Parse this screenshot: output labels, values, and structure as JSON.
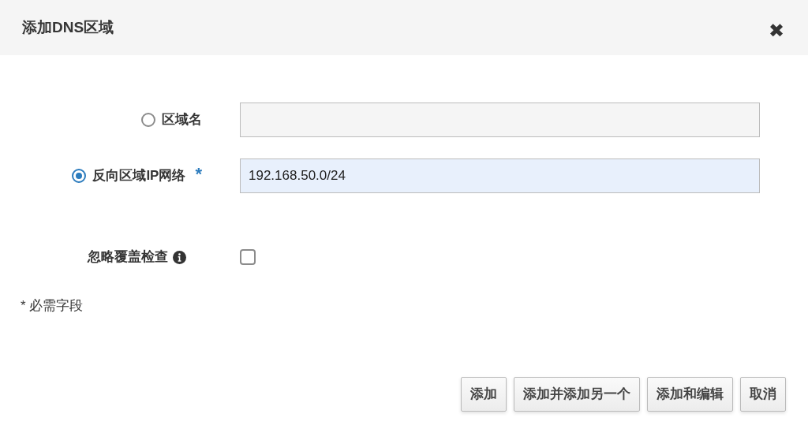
{
  "dialog": {
    "title": "添加DNS区域",
    "close": "✖"
  },
  "options": [
    {
      "label": "区域名",
      "selected": false
    },
    {
      "label": "反向区域IP网络",
      "selected": true,
      "required_mark": "*",
      "value": "192.168.50.0/24"
    }
  ],
  "skip_check": {
    "label": "忽略覆盖检查",
    "checked": false
  },
  "required_note": "* 必需字段",
  "buttons": [
    "添加",
    "添加并添加另一个",
    "添加和编辑",
    "取消"
  ]
}
